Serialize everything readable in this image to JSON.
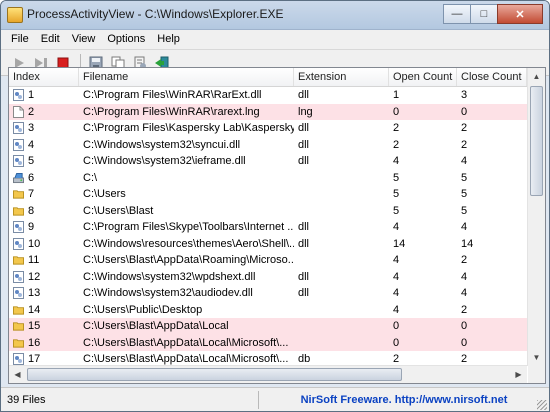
{
  "window": {
    "title": "ProcessActivityView  -  C:\\Windows\\Explorer.EXE"
  },
  "menu": [
    "File",
    "Edit",
    "View",
    "Options",
    "Help"
  ],
  "toolbar": [
    "play-icon",
    "step-icon",
    "stop-icon",
    "save-icon",
    "copy-icon",
    "properties-icon",
    "exit-icon"
  ],
  "columns": [
    "Index",
    "Filename",
    "Extension",
    "Open Count",
    "Close Count"
  ],
  "rows": [
    {
      "index": "1",
      "filename": "C:\\Program Files\\WinRAR\\RarExt.dll",
      "ext": "dll",
      "open": "1",
      "close": "3",
      "icon": "dll",
      "pink": false
    },
    {
      "index": "2",
      "filename": "C:\\Program Files\\WinRAR\\rarext.lng",
      "ext": "lng",
      "open": "0",
      "close": "0",
      "icon": "file",
      "pink": true
    },
    {
      "index": "3",
      "filename": "C:\\Program Files\\Kaspersky Lab\\Kaspersky ...",
      "ext": "dll",
      "open": "2",
      "close": "2",
      "icon": "dll",
      "pink": false
    },
    {
      "index": "4",
      "filename": "C:\\Windows\\system32\\syncui.dll",
      "ext": "dll",
      "open": "2",
      "close": "2",
      "icon": "dll",
      "pink": false
    },
    {
      "index": "5",
      "filename": "C:\\Windows\\system32\\ieframe.dll",
      "ext": "dll",
      "open": "4",
      "close": "4",
      "icon": "dll",
      "pink": false
    },
    {
      "index": "6",
      "filename": "C:\\",
      "ext": "",
      "open": "5",
      "close": "5",
      "icon": "drive",
      "pink": false
    },
    {
      "index": "7",
      "filename": "C:\\Users",
      "ext": "",
      "open": "5",
      "close": "5",
      "icon": "folder",
      "pink": false
    },
    {
      "index": "8",
      "filename": "C:\\Users\\Blast",
      "ext": "",
      "open": "5",
      "close": "5",
      "icon": "folder",
      "pink": false
    },
    {
      "index": "9",
      "filename": "C:\\Program Files\\Skype\\Toolbars\\Internet ...",
      "ext": "dll",
      "open": "4",
      "close": "4",
      "icon": "dll",
      "pink": false
    },
    {
      "index": "10",
      "filename": "C:\\Windows\\resources\\themes\\Aero\\Shell\\...",
      "ext": "dll",
      "open": "14",
      "close": "14",
      "icon": "dll",
      "pink": false
    },
    {
      "index": "11",
      "filename": "C:\\Users\\Blast\\AppData\\Roaming\\Microso...",
      "ext": "",
      "open": "4",
      "close": "2",
      "icon": "folder",
      "pink": false
    },
    {
      "index": "12",
      "filename": "C:\\Windows\\system32\\wpdshext.dll",
      "ext": "dll",
      "open": "4",
      "close": "4",
      "icon": "dll",
      "pink": false
    },
    {
      "index": "13",
      "filename": "C:\\Windows\\system32\\audiodev.dll",
      "ext": "dll",
      "open": "4",
      "close": "4",
      "icon": "dll",
      "pink": false
    },
    {
      "index": "14",
      "filename": "C:\\Users\\Public\\Desktop",
      "ext": "",
      "open": "4",
      "close": "2",
      "icon": "folder",
      "pink": false
    },
    {
      "index": "15",
      "filename": "C:\\Users\\Blast\\AppData\\Local",
      "ext": "",
      "open": "0",
      "close": "0",
      "icon": "folder",
      "pink": true
    },
    {
      "index": "16",
      "filename": "C:\\Users\\Blast\\AppData\\Local\\Microsoft\\...",
      "ext": "",
      "open": "0",
      "close": "0",
      "icon": "folder",
      "pink": true
    },
    {
      "index": "17",
      "filename": "C:\\Users\\Blast\\AppData\\Local\\Microsoft\\...",
      "ext": "db",
      "open": "2",
      "close": "2",
      "icon": "dll",
      "pink": false
    }
  ],
  "status": {
    "count": "39 Files",
    "link": "NirSoft Freeware.  http://www.nirsoft.net"
  },
  "colors": {
    "pink_row": "#fde1e6",
    "link": "#0b42c2",
    "stop": "#d81e1e"
  }
}
